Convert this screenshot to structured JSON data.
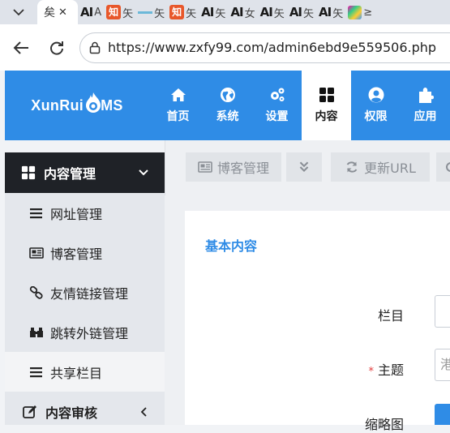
{
  "browser": {
    "active_tab_title": "矣",
    "active_tab_close": "✕",
    "tabs": [
      {
        "icon": "ai-favicon",
        "text": "AI",
        "label": "A"
      },
      {
        "icon": "zhihu-favicon",
        "text": "知",
        "label": "矢"
      },
      {
        "icon": "line-favicon",
        "text": "",
        "label": "矢"
      },
      {
        "icon": "zhihu-favicon",
        "text": "知",
        "label": "矢"
      },
      {
        "icon": "ai-favicon",
        "text": "AI",
        "label": "矢"
      },
      {
        "icon": "ai-favicon",
        "text": "AI",
        "label": "女"
      },
      {
        "icon": "ai-favicon",
        "text": "AI",
        "label": "矢"
      },
      {
        "icon": "ai-favicon",
        "text": "AI",
        "label": "矢"
      },
      {
        "icon": "ai-favicon",
        "text": "AI",
        "label": "矢"
      },
      {
        "icon": "apps-favicon",
        "text": "",
        "label": "≥"
      }
    ],
    "url": "https://www.zxfy99.com/admin6ebd9e559506.php"
  },
  "app": {
    "brand_left": "XunRui",
    "brand_right": "MS",
    "brand_color": "#2f8ce6",
    "top_nav": [
      {
        "label": "首页",
        "icon": "home-icon"
      },
      {
        "label": "系统",
        "icon": "globe-icon"
      },
      {
        "label": "设置",
        "icon": "cogs-icon"
      },
      {
        "label": "内容",
        "icon": "grid-icon",
        "active": true
      },
      {
        "label": "权限",
        "icon": "user-icon"
      },
      {
        "label": "应用",
        "icon": "puzzle-icon"
      }
    ]
  },
  "sidebar": {
    "section_title": "内容管理",
    "items": [
      {
        "label": "网址管理",
        "icon": "list-icon"
      },
      {
        "label": "博客管理",
        "icon": "newspaper-icon"
      },
      {
        "label": "友情链接管理",
        "icon": "link-icon"
      },
      {
        "label": "跳转外链管理",
        "icon": "binoculars-icon"
      },
      {
        "label": "共享栏目",
        "icon": "list-icon"
      }
    ],
    "bottom_section": "内容审核"
  },
  "toolbar": {
    "blog_button": "博客管理",
    "dropdown_icon": "double-chevron-down-icon",
    "refresh_url": "更新URL"
  },
  "panel": {
    "title": "基本内容",
    "fields": [
      {
        "label": "栏目",
        "required": false
      },
      {
        "label": "主题",
        "required": true,
        "required_mark": "*",
        "value": "港"
      },
      {
        "label": "缩略图",
        "required": false
      }
    ]
  }
}
